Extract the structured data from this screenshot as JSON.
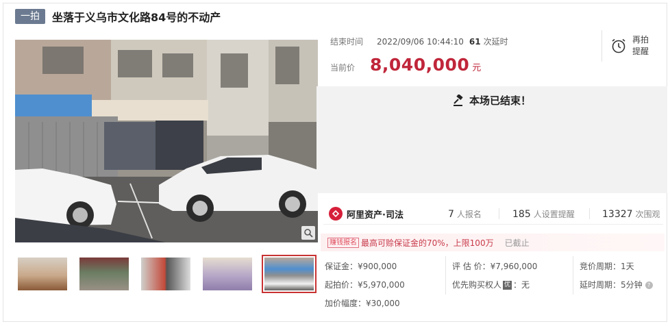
{
  "header": {
    "tag": "一拍",
    "title": "坐落于义乌市文化路84号的不动产"
  },
  "auction": {
    "end_label": "结束时间",
    "end_time": "2022/09/06 10:44:10",
    "extensions_count": "61",
    "extensions_label": "次延时",
    "price_label": "当前价",
    "price": "8,040,000",
    "price_unit": "元",
    "remind_line1": "再拍",
    "remind_line2": "提醒",
    "ended_message": "本场已结束！"
  },
  "stats": {
    "brand": "阿里资产·司法",
    "registrations": "7",
    "registrations_label": "人报名",
    "reminders": "185",
    "reminders_label": "人设置提醒",
    "watchers": "13327",
    "watchers_label": "次围观"
  },
  "notice": {
    "badge": "赚钱报名",
    "text": "最高可赊保证金的70%，上限100万",
    "status": "已截止"
  },
  "details": {
    "deposit": "保证金：¥900,000",
    "start_price": "起拍价：¥5,970,000",
    "increment": "加价幅度：¥30,000",
    "appraisal": "评 估 价：¥7,960,000",
    "priority_label": "优先购买权人",
    "priority_badge": "优",
    "priority_value": "：无",
    "bid_period": "竞价周期：1天",
    "extension_period": "延时周期：5分钟"
  },
  "icons": {
    "zoom": "magnifier-icon",
    "alarm": "alarm-clock-icon",
    "gavel": "gavel-icon",
    "brand": "ali-assets-logo-icon",
    "help": "help-icon"
  },
  "colors": {
    "price": "#c0263a",
    "tag_bg": "#6b7a90",
    "active_thumb": "#c83232",
    "brand": "#d61f3a"
  }
}
